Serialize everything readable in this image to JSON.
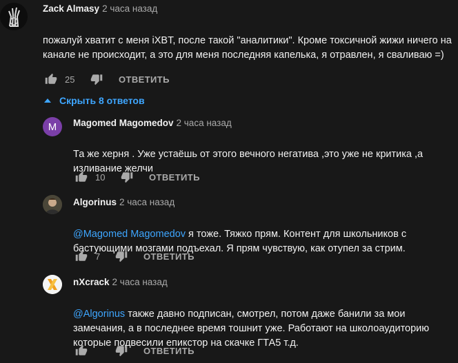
{
  "main_comment": {
    "author": "Zack Almasy",
    "time": "2 часа назад",
    "text": "пожалуй хватит с меня iXBT, после такой \"аналитики\". Кроме токсичной жижи ничего на канале не происходит, а это для меня последняя капелька,  я отравлен, я сваливаю =)",
    "likes": "25",
    "reply_label": "ОТВЕТИТЬ"
  },
  "replies_toggle": {
    "label": "Скрыть 8 ответов"
  },
  "replies": [
    {
      "author": "Magomed Magomedov",
      "time": "2 часа назад",
      "avatar_letter": "M",
      "avatar_color": "#7b3fa8",
      "mention": "",
      "text": "Та же херня . Уже устаёшь от этого вечного негатива ,это уже не критика ,а изливание желчи",
      "likes": "10",
      "reply_label": "ОТВЕТИТЬ"
    },
    {
      "author": "Algorinus",
      "time": "2 часа назад",
      "mention": "@Magomed Magomedov",
      "text": " я тоже. Тяжко прям. Контент для школьников с бастующими мозгами подъехал. Я прям чувствую, как отупел за стрим.",
      "likes": "7",
      "reply_label": "ОТВЕТИТЬ"
    },
    {
      "author": "nXcrack",
      "time": "2 часа назад",
      "mention": "@Algorinus",
      "text": " также давно подписан, смотрел, потом даже банили за мои замечания, а в последнее время тошнит уже. Работают на школоаудиторию которые подвесили епикстор на скачке ГТА5 т.д.",
      "likes": "",
      "reply_label": "ОТВЕТИТЬ"
    }
  ],
  "colors": {
    "link": "#3ea6ff",
    "background": "#181818",
    "muted": "#aaaaaa"
  }
}
